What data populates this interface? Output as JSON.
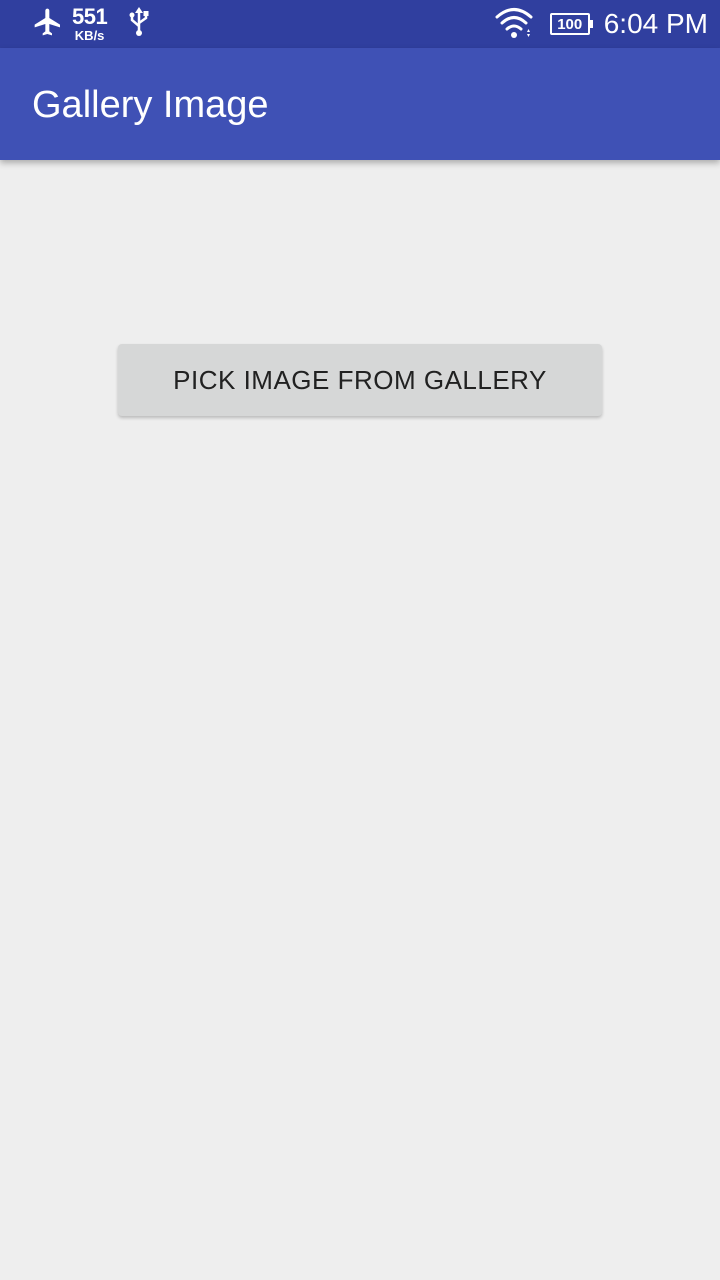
{
  "status_bar": {
    "left_icons": [
      "airplane-icon",
      "usb-icon"
    ],
    "network_speed": {
      "value": "551",
      "unit": "KB/s"
    },
    "right_icons": [
      "wifi-icon"
    ],
    "battery_level": "100",
    "time": "6:04 PM",
    "color": "#303f9f"
  },
  "app_bar": {
    "title": "Gallery Image",
    "color": "#3f51b5"
  },
  "main": {
    "pick_button_label": "PICK IMAGE FROM GALLERY"
  },
  "colors": {
    "background": "#eeeeee",
    "button": "#d6d7d7",
    "button_text": "#212121"
  }
}
